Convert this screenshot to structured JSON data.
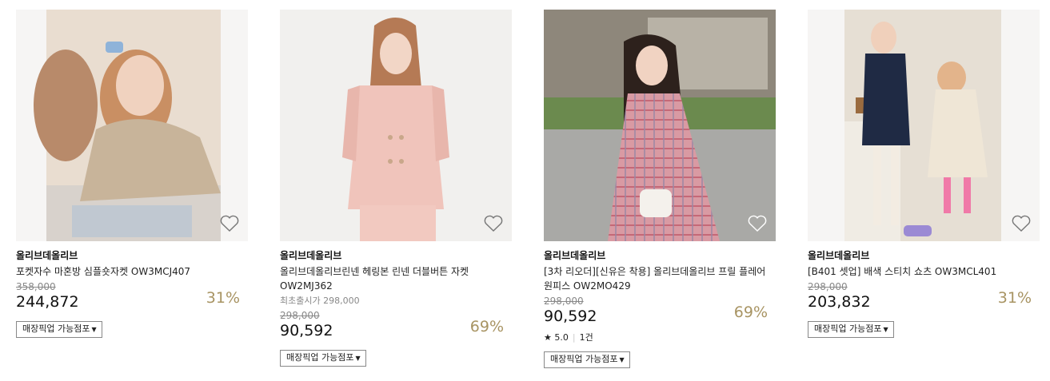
{
  "products": [
    {
      "brand": "올리브데올리브",
      "name": "포켓자수 마혼방 심플숏자켓 OW3MCJ407",
      "first_price_label": "",
      "original_price": "358,000",
      "price": "244,872",
      "discount": "31%",
      "rating": "",
      "review_count": "",
      "pickup_label": "매장픽업 가능점포",
      "heart_icon": "heart-outline-icon"
    },
    {
      "brand": "올리브데올리브",
      "name": "올리브데올리브린넨 헤링본 린넨 더블버튼 자켓 OW2MJ362",
      "first_price_label": "최초출시가 298,000",
      "original_price": "298,000",
      "price": "90,592",
      "discount": "69%",
      "rating": "",
      "review_count": "",
      "pickup_label": "매장픽업 가능점포",
      "heart_icon": "heart-outline-icon"
    },
    {
      "brand": "올리브데올리브",
      "name": "[3차 리오더][신유은 착용] 올리브데올리브 프릴 플레어 원피스 OW2MO429",
      "first_price_label": "",
      "original_price": "298,000",
      "price": "90,592",
      "discount": "69%",
      "rating": "5.0",
      "review_count": "1건",
      "pickup_label": "매장픽업 가능점포",
      "heart_icon": "heart-outline-icon"
    },
    {
      "brand": "올리브데올리브",
      "name": "[B401 셋업] 배색 스티치 쇼츠 OW3MCL401",
      "first_price_label": "",
      "original_price": "298,000",
      "price": "203,832",
      "discount": "31%",
      "rating": "",
      "review_count": "",
      "pickup_label": "매장픽업 가능점포",
      "heart_icon": "heart-outline-icon"
    }
  ],
  "colors": {
    "discount": "#a89463",
    "muted": "#888888",
    "bg": "#f5f5f5"
  }
}
